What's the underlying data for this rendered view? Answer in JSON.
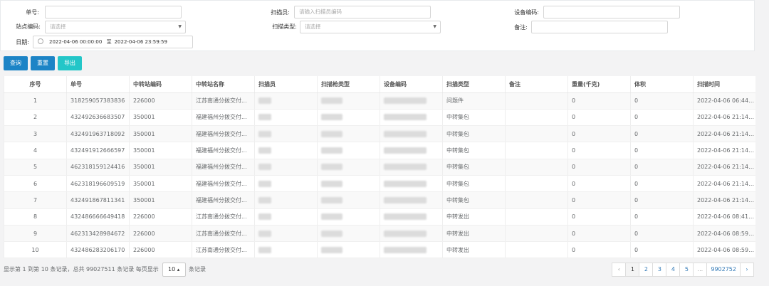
{
  "filters": {
    "order_no_label": "单号:",
    "scanner_label": "扫描员:",
    "scanner_placeholder": "请输入扫描员编码",
    "device_code_label": "设备编码:",
    "site_code_label": "站点编码:",
    "site_code_placeholder": "请选择",
    "scan_type_label": "扫描类型:",
    "scan_type_placeholder": "请选择",
    "remark_label": "备注:",
    "date_label": "日期:",
    "date_start": "2022-04-06 00:00:00",
    "date_sep": "至",
    "date_end": "2022-04-06 23:59:59"
  },
  "toolbar": {
    "query_label": "查询",
    "reset_label": "重置",
    "export_label": "导出"
  },
  "table": {
    "columns": [
      "序号",
      "单号",
      "中转站编码",
      "中转站名称",
      "扫描员",
      "扫描枪类型",
      "设备编码",
      "扫描类型",
      "备注",
      "重量(千克)",
      "体积",
      "扫描时间"
    ],
    "rows": [
      {
        "idx": "1",
        "order": "318259057383836",
        "station_code": "226000",
        "station_name": "江苏南通分拨交付...",
        "scan_type": "问题件",
        "remark": "",
        "weight": "0",
        "volume": "0",
        "time": "2022-04-06 06:44:..."
      },
      {
        "idx": "2",
        "order": "432492636683507",
        "station_code": "350001",
        "station_name": "福建福州分拨交付...",
        "scan_type": "中转集包",
        "remark": "",
        "weight": "0",
        "volume": "0",
        "time": "2022-04-06 21:14:..."
      },
      {
        "idx": "3",
        "order": "432491963718092",
        "station_code": "350001",
        "station_name": "福建福州分拨交付...",
        "scan_type": "中转集包",
        "remark": "",
        "weight": "0",
        "volume": "0",
        "time": "2022-04-06 21:14:..."
      },
      {
        "idx": "4",
        "order": "432491912666597",
        "station_code": "350001",
        "station_name": "福建福州分拨交付...",
        "scan_type": "中转集包",
        "remark": "",
        "weight": "0",
        "volume": "0",
        "time": "2022-04-06 21:14:..."
      },
      {
        "idx": "5",
        "order": "462318159124416",
        "station_code": "350001",
        "station_name": "福建福州分拨交付...",
        "scan_type": "中转集包",
        "remark": "",
        "weight": "0",
        "volume": "0",
        "time": "2022-04-06 21:14:..."
      },
      {
        "idx": "6",
        "order": "462318196609519",
        "station_code": "350001",
        "station_name": "福建福州分拨交付...",
        "scan_type": "中转集包",
        "remark": "",
        "weight": "0",
        "volume": "0",
        "time": "2022-04-06 21:14:..."
      },
      {
        "idx": "7",
        "order": "432491867811341",
        "station_code": "350001",
        "station_name": "福建福州分拨交付...",
        "scan_type": "中转集包",
        "remark": "",
        "weight": "0",
        "volume": "0",
        "time": "2022-04-06 21:14:..."
      },
      {
        "idx": "8",
        "order": "432486666649418",
        "station_code": "226000",
        "station_name": "江苏南通分拨交付...",
        "scan_type": "中转发出",
        "remark": "",
        "weight": "0",
        "volume": "0",
        "time": "2022-04-06 08:41:..."
      },
      {
        "idx": "9",
        "order": "462313428984672",
        "station_code": "226000",
        "station_name": "江苏南通分拨交付...",
        "scan_type": "中转发出",
        "remark": "",
        "weight": "0",
        "volume": "0",
        "time": "2022-04-06 08:59:..."
      },
      {
        "idx": "10",
        "order": "432486283206170",
        "station_code": "226000",
        "station_name": "江苏南通分拨交付...",
        "scan_type": "中转发出",
        "remark": "",
        "weight": "0",
        "volume": "0",
        "time": "2022-04-06 08:59:..."
      }
    ]
  },
  "footer": {
    "summary": "显示第 1 到第 10 条记录，总共 99027511 条记录 每页显示",
    "page_size": "10",
    "page_size_caret": "▴",
    "suffix": "条记录"
  },
  "pager": {
    "prev": "‹",
    "pages": [
      "1",
      "2",
      "3",
      "4",
      "5",
      "...",
      "9902752"
    ],
    "next": "›"
  },
  "colors": {
    "primary": "#1c84c6",
    "info": "#23c6c8"
  }
}
